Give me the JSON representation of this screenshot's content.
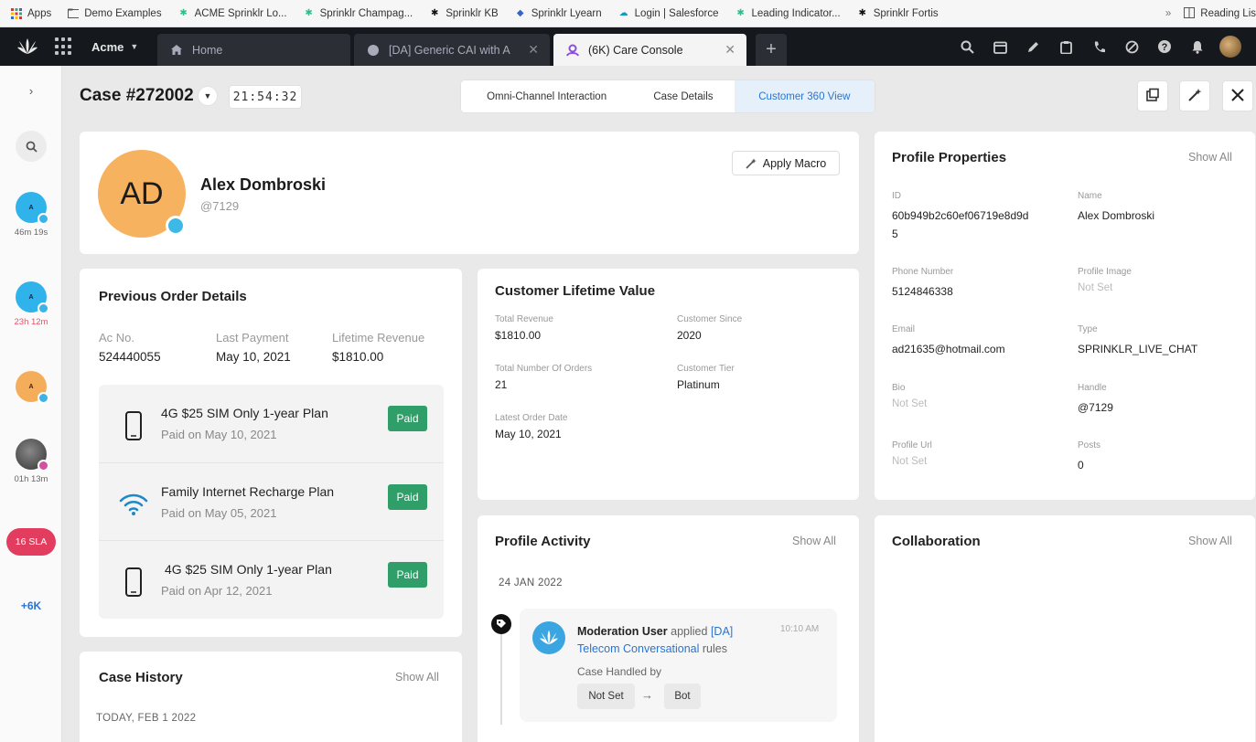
{
  "bookmarks": {
    "items": [
      "Apps",
      "Demo Examples",
      "ACME Sprinklr Lo...",
      "Sprinklr Champag...",
      "Sprinklr KB",
      "Sprinklr Lyearn",
      "Login | Salesforce",
      "Leading Indicator...",
      "Sprinklr Fortis"
    ],
    "overflow": "»",
    "reading_list": "Reading Lis"
  },
  "topbar": {
    "workspace": "Acme",
    "tabs": [
      {
        "label": "Home"
      },
      {
        "label": "[DA] Generic CAI with A"
      },
      {
        "label": "(6K) Care Console"
      }
    ]
  },
  "rail": {
    "conversations": [
      {
        "initial": "A",
        "time": "46m 19s",
        "color": "#2fb3ea"
      },
      {
        "initial": "A",
        "time": "23h 12m",
        "color": "#2fb3ea"
      },
      {
        "initial": "A",
        "time": "",
        "color": "#f4ad5a"
      },
      {
        "initial": "",
        "time": "01h 13m",
        "color": "#444444"
      }
    ],
    "sla": "16 SLA",
    "more": "+6K"
  },
  "case": {
    "title": "Case #272002",
    "timer": "21:54:32",
    "view_tabs": [
      "Omni-Channel Interaction",
      "Case Details",
      "Customer 360 View"
    ],
    "active_view": "Customer 360 View"
  },
  "profile": {
    "initials": "AD",
    "name": "Alex Dombroski",
    "handle": "@7129",
    "apply_macro": "Apply Macro"
  },
  "orders": {
    "title": "Previous Order Details",
    "ac_no_label": "Ac No.",
    "ac_no": "524440055",
    "last_payment_label": "Last Payment",
    "last_payment": "May 10, 2021",
    "lifetime_revenue_label": "Lifetime Revenue",
    "lifetime_revenue": "$1810.00",
    "items": [
      {
        "name": "4G $25 SIM Only 1-year Plan",
        "paid_on": "Paid on May 10, 2021",
        "status": "Paid",
        "icon": "phone-icon"
      },
      {
        "name": "Family Internet Recharge Plan",
        "paid_on": "Paid on May 05, 2021",
        "status": "Paid",
        "icon": "wifi-icon"
      },
      {
        "name": "4G $25 SIM Only 1-year Plan",
        "paid_on": "Paid on Apr 12, 2021",
        "status": "Paid",
        "icon": "phone-icon"
      }
    ]
  },
  "case_history": {
    "title": "Case History",
    "show_all": "Show All",
    "date": "TODAY, FEB 1 2022"
  },
  "clv": {
    "title": "Customer Lifetime Value",
    "total_revenue_label": "Total Revenue",
    "total_revenue": "$1810.00",
    "customer_since_label": "Customer Since",
    "customer_since": "2020",
    "total_orders_label": "Total Number Of Orders",
    "total_orders": "21",
    "customer_tier_label": "Customer Tier",
    "customer_tier": "Platinum",
    "latest_order_label": "Latest Order Date",
    "latest_order": "May 10, 2021"
  },
  "activity": {
    "title": "Profile Activity",
    "show_all": "Show All",
    "date": "24 JAN 2022",
    "actor": "Moderation User",
    "verb": "applied",
    "link_part1": "[DA]",
    "link_part2": "Telecom Conversational",
    "suffix": "rules",
    "time": "10:10 AM",
    "handled_by_label": "Case Handled by",
    "from": "Not Set",
    "arrow": "→",
    "to": "Bot"
  },
  "properties": {
    "title": "Profile Properties",
    "show_all": "Show All",
    "id_label": "ID",
    "id_line1": "60b949b2c60ef06719e8d9d",
    "id_line2": "5",
    "name_label": "Name",
    "name": "Alex Dombroski",
    "phone_label": "Phone Number",
    "phone": "5124846338",
    "image_label": "Profile Image",
    "image": "Not Set",
    "email_label": "Email",
    "email": "ad21635@hotmail.com",
    "type_label": "Type",
    "type": "SPRINKLR_LIVE_CHAT",
    "bio_label": "Bio",
    "bio": "Not Set",
    "handle_label": "Handle",
    "handle": "@7129",
    "url_label": "Profile Url",
    "url": "Not Set",
    "posts_label": "Posts",
    "posts": "0"
  },
  "collaboration": {
    "title": "Collaboration",
    "show_all": "Show All"
  },
  "colors": {
    "accent": "#2a74d0",
    "paid": "#2f9e68",
    "sla": "#e23d5e",
    "avatar": "#f7b260"
  }
}
